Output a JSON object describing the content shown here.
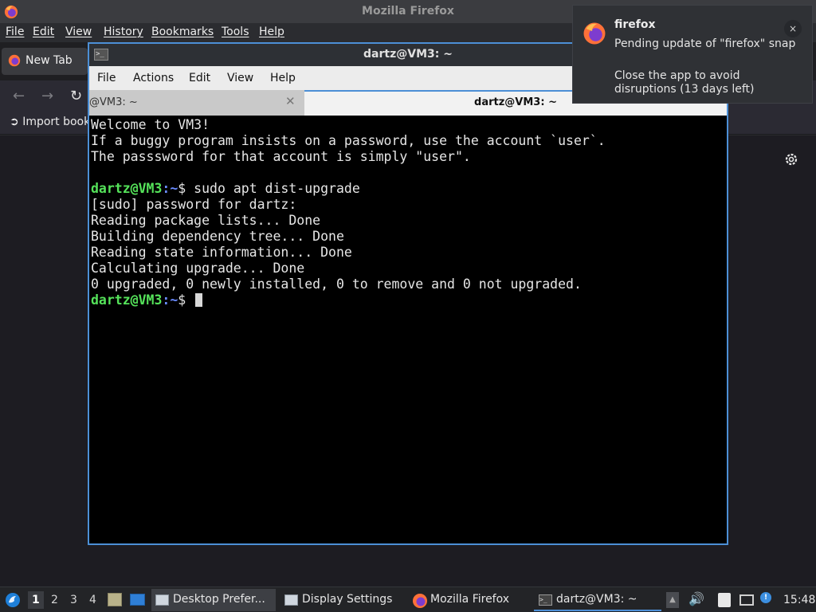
{
  "firefox": {
    "window_title": "Mozilla Firefox",
    "menu": [
      "File",
      "Edit",
      "View",
      "History",
      "Bookmarks",
      "Tools",
      "Help"
    ],
    "tab_label": "New Tab",
    "import_bookmarks": "Import book",
    "icons": {
      "back": "arrow-left-icon",
      "forward": "arrow-right-icon",
      "reload": "reload-icon",
      "settings": "gear-icon"
    }
  },
  "terminal": {
    "window_title": "dartz@VM3: ~",
    "menu": [
      "File",
      "Actions",
      "Edit",
      "View",
      "Help"
    ],
    "tabs": [
      {
        "label": "@VM3: ~",
        "active": false
      },
      {
        "label": "dartz@VM3: ~",
        "active": true
      }
    ],
    "lines": [
      {
        "text": "Welcome to VM3!"
      },
      {
        "text": "If a buggy program insists on a password, use the account `user`."
      },
      {
        "text": "The passsword for that account is simply \"user\"."
      },
      {
        "text": ""
      },
      {
        "prompt_user": "dartz@VM3",
        "prompt_path": ":~",
        "prompt_sym": "$ ",
        "text": "sudo apt dist-upgrade"
      },
      {
        "text": "[sudo] password for dartz:"
      },
      {
        "text": "Reading package lists... Done"
      },
      {
        "text": "Building dependency tree... Done"
      },
      {
        "text": "Reading state information... Done"
      },
      {
        "text": "Calculating upgrade... Done"
      },
      {
        "text": "0 upgraded, 0 newly installed, 0 to remove and 0 not upgraded."
      },
      {
        "prompt_user": "dartz@VM3",
        "prompt_path": ":~",
        "prompt_sym": "$ ",
        "text": ""
      }
    ],
    "colors": {
      "prompt_user": "#55e35a",
      "prompt_path": "#6a8bff",
      "background": "#000000"
    }
  },
  "notification": {
    "app": "firefox",
    "message1": "Pending update of \"firefox\" snap",
    "message2": "Close the app to avoid disruptions (13 days left)",
    "close_label": "×"
  },
  "taskbar": {
    "workspaces": [
      "1",
      "2",
      "3",
      "4"
    ],
    "active_workspace": "1",
    "tasks": [
      {
        "label": "Desktop Prefer...",
        "icon": "desktop-prefs-icon"
      },
      {
        "label": "Display Settings",
        "icon": "display-settings-icon"
      },
      {
        "label": "Mozilla Firefox",
        "icon": "firefox-icon"
      },
      {
        "label": "dartz@VM3: ~",
        "icon": "terminal-icon"
      }
    ],
    "clock": "15:48"
  },
  "accent_color": "#4c8fd6"
}
